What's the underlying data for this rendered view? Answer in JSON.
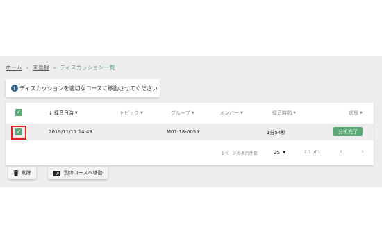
{
  "breadcrumb": {
    "home": "ホーム",
    "unregistered": "未登録",
    "current": "ディスカッション一覧",
    "separator": "›"
  },
  "notice": {
    "text": "ディスカッションを適切なコースに移動させてください"
  },
  "table": {
    "headers": {
      "recorded_at": "録音日時",
      "topic": "トピック",
      "group": "グループ",
      "member": "メンバー",
      "duration": "録音時間",
      "status": "状態"
    },
    "rows": [
      {
        "recorded_at": "2019/11/11 14:49",
        "topic": "",
        "group": "M01-18-0059",
        "member": "",
        "duration": "1分54秒",
        "status": "分析完了",
        "checked": true
      }
    ],
    "pagination": {
      "rows_per_page_label": "1ページの表示件数",
      "rows_per_page_value": "25",
      "range": "1-1 of 1"
    }
  },
  "actions": {
    "delete_label": "削除",
    "move_label": "別のコースへ移動"
  },
  "colors": {
    "accent_green": "#5aa876",
    "highlight_red": "#e02020",
    "info_blue": "#2f5f8c"
  }
}
